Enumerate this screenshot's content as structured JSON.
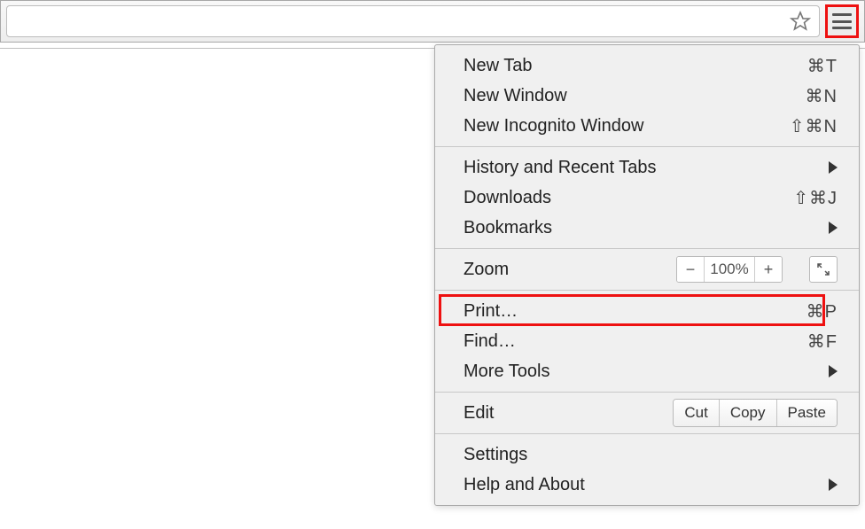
{
  "toolbar": {
    "address_value": ""
  },
  "menu": {
    "sections": [
      {
        "items": [
          {
            "label": "New Tab",
            "shortcut": "⌘T"
          },
          {
            "label": "New Window",
            "shortcut": "⌘N"
          },
          {
            "label": "New Incognito Window",
            "shortcut": "⇧⌘N"
          }
        ]
      },
      {
        "items": [
          {
            "label": "History and Recent Tabs",
            "submenu": true
          },
          {
            "label": "Downloads",
            "shortcut": "⇧⌘J"
          },
          {
            "label": "Bookmarks",
            "submenu": true
          }
        ]
      },
      {
        "zoom": {
          "label": "Zoom",
          "level": "100%",
          "minus": "−",
          "plus": "+"
        }
      },
      {
        "items": [
          {
            "label": "Print…",
            "shortcut": "⌘P",
            "highlighted": true
          },
          {
            "label": "Find…",
            "shortcut": "⌘F"
          },
          {
            "label": "More Tools",
            "submenu": true
          }
        ]
      },
      {
        "edit": {
          "label": "Edit",
          "cut": "Cut",
          "copy": "Copy",
          "paste": "Paste"
        }
      },
      {
        "items": [
          {
            "label": "Settings"
          },
          {
            "label": "Help and About",
            "submenu": true
          }
        ]
      }
    ]
  }
}
